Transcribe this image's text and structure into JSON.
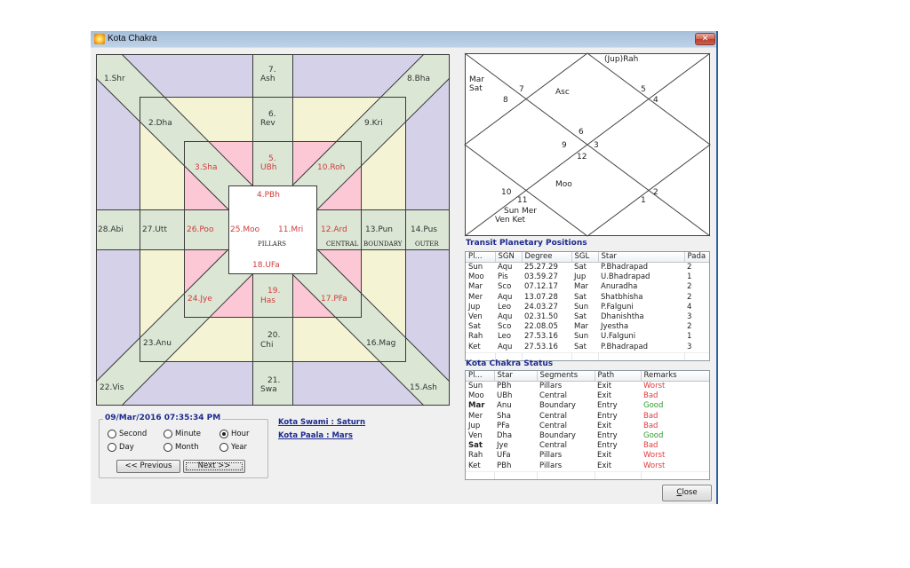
{
  "window": {
    "title": "Kota Chakra",
    "close_glyph": "✕",
    "close_button_label": "Close"
  },
  "colors": {
    "outer_ring": "#d5d1e9",
    "boundary_ring": "#f4f4d5",
    "central_ring": "#fcc8d6",
    "band": "#dbe6d5",
    "highlight_text": "#d23b3b",
    "heading_text": "#1c2b8f",
    "good_text": "#2f9a2f",
    "bad_text": "#e33b3b"
  },
  "chakra": {
    "stars": [
      {
        "num": "1.",
        "name": "Shr",
        "highlighted": false
      },
      {
        "num": "2.",
        "name": "Dha",
        "highlighted": false
      },
      {
        "num": "3.",
        "name": "Sha",
        "highlighted": true
      },
      {
        "num": "4.",
        "name": "PBh",
        "highlighted": true
      },
      {
        "num": "5.",
        "name": "UBh",
        "highlighted": true
      },
      {
        "num": "6.",
        "name": "Rev",
        "highlighted": false
      },
      {
        "num": "7.",
        "name": "Ash",
        "highlighted": false
      },
      {
        "num": "8.",
        "name": "Bha",
        "highlighted": false
      },
      {
        "num": "9.",
        "name": "Kri",
        "highlighted": false
      },
      {
        "num": "10.",
        "name": "Roh",
        "highlighted": true
      },
      {
        "num": "11.",
        "name": "Mri",
        "highlighted": true
      },
      {
        "num": "12.",
        "name": "Ard",
        "highlighted": true
      },
      {
        "num": "13.",
        "name": "Pun",
        "highlighted": false
      },
      {
        "num": "14.",
        "name": "Pus",
        "highlighted": false
      },
      {
        "num": "15.",
        "name": "Ash",
        "highlighted": false
      },
      {
        "num": "16.",
        "name": "Mag",
        "highlighted": false
      },
      {
        "num": "17.",
        "name": "PFa",
        "highlighted": true
      },
      {
        "num": "18.",
        "name": "UFa",
        "highlighted": true
      },
      {
        "num": "19.",
        "name": "Has",
        "highlighted": true
      },
      {
        "num": "20.",
        "name": "Chi",
        "highlighted": false
      },
      {
        "num": "21.",
        "name": "Swa",
        "highlighted": false
      },
      {
        "num": "22.",
        "name": "Vis",
        "highlighted": false
      },
      {
        "num": "23.",
        "name": "Anu",
        "highlighted": false
      },
      {
        "num": "24.",
        "name": "Jye",
        "highlighted": true
      },
      {
        "num": "25.",
        "name": "Moo",
        "highlighted": true
      },
      {
        "num": "26.",
        "name": "Poo",
        "highlighted": true
      },
      {
        "num": "27.",
        "name": "Utt",
        "highlighted": false
      },
      {
        "num": "28.",
        "name": "Abi",
        "highlighted": false
      }
    ],
    "segments": {
      "pillars": "PILLARS",
      "central": "CENTRAL",
      "boundary": "BOUNDARY",
      "outer": "OUTER"
    }
  },
  "kundli": {
    "house_numbers": [
      "7",
      "8",
      "5",
      "4",
      "6",
      "9",
      "3",
      "12",
      "10",
      "11",
      "2",
      "1"
    ],
    "planet_labels": [
      "(Jup)Rah",
      "Mar",
      "Sat",
      "Asc",
      "Moo",
      "Sun Mer",
      "Ven Ket"
    ]
  },
  "transit": {
    "title": "Transit Planetary Positions",
    "columns": [
      "Pl...",
      "SGN",
      "Degree",
      "SGL",
      "Star",
      "Pada"
    ],
    "rows": [
      [
        "Sun",
        "Aqu",
        "25.27.29",
        "Sat",
        "P.Bhadrapad",
        "2"
      ],
      [
        "Moo",
        "Pis",
        "03.59.27",
        "Jup",
        "U.Bhadrapad",
        "1"
      ],
      [
        "Mar",
        "Sco",
        "07.12.17",
        "Mar",
        "Anuradha",
        "2"
      ],
      [
        "Mer",
        "Aqu",
        "13.07.28",
        "Sat",
        "Shatbhisha",
        "2"
      ],
      [
        "Jup",
        "Leo",
        "24.03.27",
        "Sun",
        "P.Falguni",
        "4"
      ],
      [
        "Ven",
        "Aqu",
        "02.31.50",
        "Sat",
        "Dhanishtha",
        "3"
      ],
      [
        "Sat",
        "Sco",
        "22.08.05",
        "Mar",
        "Jyestha",
        "2"
      ],
      [
        "Rah",
        "Leo",
        "27.53.16",
        "Sun",
        "U.Falguni",
        "1"
      ],
      [
        "Ket",
        "Aqu",
        "27.53.16",
        "Sat",
        "P.Bhadrapad",
        "3"
      ]
    ]
  },
  "status": {
    "title": "Kota Chakra Status",
    "columns": [
      "Pl...",
      "Star",
      "Segments",
      "Path",
      "Remarks"
    ],
    "rows": [
      {
        "planet": "Sun",
        "star": "PBh",
        "segment": "Pillars",
        "path": "Exit",
        "remark": "Worst",
        "tone": "bad",
        "bold": false
      },
      {
        "planet": "Moo",
        "star": "UBh",
        "segment": "Central",
        "path": "Exit",
        "remark": "Bad",
        "tone": "bad",
        "bold": false
      },
      {
        "planet": "Mar",
        "star": "Anu",
        "segment": "Boundary",
        "path": "Entry",
        "remark": "Good",
        "tone": "good",
        "bold": true
      },
      {
        "planet": "Mer",
        "star": "Sha",
        "segment": "Central",
        "path": "Entry",
        "remark": "Bad",
        "tone": "bad",
        "bold": false
      },
      {
        "planet": "Jup",
        "star": "PFa",
        "segment": "Central",
        "path": "Exit",
        "remark": "Bad",
        "tone": "bad",
        "bold": false
      },
      {
        "planet": "Ven",
        "star": "Dha",
        "segment": "Boundary",
        "path": "Entry",
        "remark": "Good",
        "tone": "good",
        "bold": false
      },
      {
        "planet": "Sat",
        "star": "Jye",
        "segment": "Central",
        "path": "Entry",
        "remark": "Bad",
        "tone": "bad",
        "bold": true
      },
      {
        "planet": "Rah",
        "star": "UFa",
        "segment": "Pillars",
        "path": "Exit",
        "remark": "Worst",
        "tone": "bad",
        "bold": false
      },
      {
        "planet": "Ket",
        "star": "PBh",
        "segment": "Pillars",
        "path": "Exit",
        "remark": "Worst",
        "tone": "bad",
        "bold": false
      }
    ]
  },
  "datetime": {
    "value": "09/Mar/2016 07:35:34 PM",
    "units": [
      {
        "label": "Second",
        "checked": false
      },
      {
        "label": "Minute",
        "checked": false
      },
      {
        "label": "Hour",
        "checked": true
      },
      {
        "label": "Day",
        "checked": false
      },
      {
        "label": "Month",
        "checked": false
      },
      {
        "label": "Year",
        "checked": false
      }
    ],
    "previous_label": "<<  Previous",
    "next_label": "Next >>"
  },
  "kota": {
    "swami": "Kota Swami : Saturn",
    "paala": "Kota Paala : Mars"
  }
}
